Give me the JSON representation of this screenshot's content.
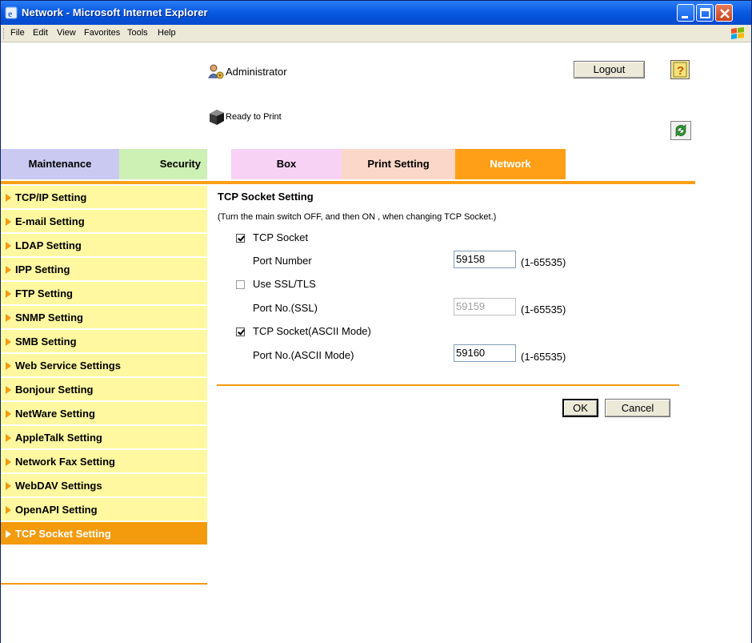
{
  "window": {
    "title": "Network - Microsoft Internet Explorer"
  },
  "menu": {
    "items": [
      {
        "label": "File"
      },
      {
        "label": "Edit"
      },
      {
        "label": "View"
      },
      {
        "label": "Favorites"
      },
      {
        "label": "Tools"
      },
      {
        "label": "Help"
      }
    ]
  },
  "header": {
    "user": "Administrator",
    "status": "Ready to Print",
    "logout_label": "Logout"
  },
  "tabs": [
    {
      "label": "Maintenance",
      "color": "#c9c9f2"
    },
    {
      "label": "Security",
      "color": "#cdf0b5"
    },
    {
      "label": "Box",
      "color": "#f8d2f4"
    },
    {
      "label": "Print Setting",
      "color": "#fad7c8"
    },
    {
      "label": "Network",
      "color": "#ff9f18",
      "active": true
    }
  ],
  "sidebar": {
    "items": [
      {
        "label": "TCP/IP Setting"
      },
      {
        "label": "E-mail Setting"
      },
      {
        "label": "LDAP Setting"
      },
      {
        "label": "IPP Setting"
      },
      {
        "label": "FTP Setting"
      },
      {
        "label": "SNMP Setting"
      },
      {
        "label": "SMB Setting"
      },
      {
        "label": "Web Service Settings"
      },
      {
        "label": "Bonjour Setting"
      },
      {
        "label": "NetWare Setting"
      },
      {
        "label": "AppleTalk Setting"
      },
      {
        "label": "Network Fax Setting"
      },
      {
        "label": "WebDAV Settings"
      },
      {
        "label": "OpenAPI Setting"
      },
      {
        "label": "TCP Socket Setting",
        "active": true
      }
    ]
  },
  "main": {
    "title": "TCP Socket Setting",
    "note": "(Turn the main switch OFF, and then ON , when changing TCP Socket.)",
    "tcp_socket": {
      "label": "TCP Socket",
      "checked": true
    },
    "port_number": {
      "label": "Port Number",
      "value": "59158",
      "range": "(1-65535)"
    },
    "use_ssl": {
      "label": "Use SSL/TLS",
      "checked": false
    },
    "port_ssl": {
      "label": "Port No.(SSL)",
      "value": "59159",
      "range": "(1-65535)"
    },
    "tcp_ascii": {
      "label": "TCP Socket(ASCII Mode)",
      "checked": true
    },
    "port_ascii": {
      "label": "Port No.(ASCII Mode)",
      "value": "59160",
      "range": "(1-65535)"
    },
    "ok_label": "OK",
    "cancel_label": "Cancel"
  },
  "colors": {
    "accent": "#f39a0d",
    "sidebar_bg": "#fff8a0"
  }
}
